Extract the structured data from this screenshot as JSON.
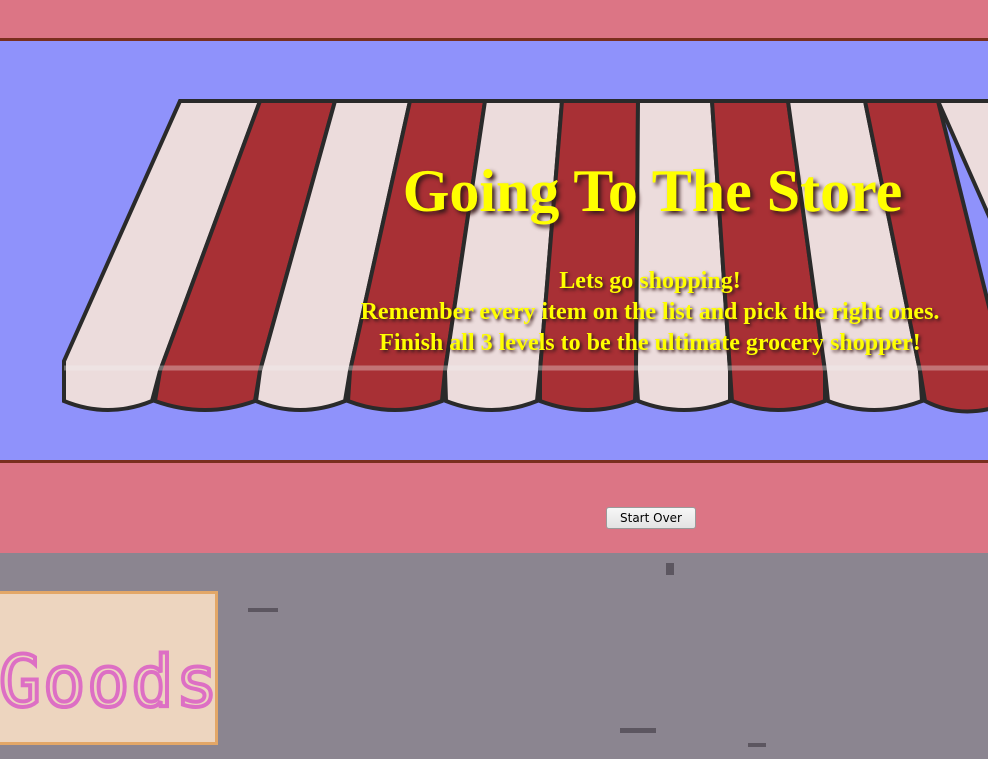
{
  "game": {
    "title": "Going To The Store",
    "messages": [
      "Lets go shopping!",
      "Remember every item on the list and pick the right ones.",
      "Finish all 3 levels to be the ultimate grocery shopper!"
    ],
    "start_over_label": "Start Over",
    "sign_text": "Goods"
  },
  "colors": {
    "top_band": "#dc7585",
    "sky": "#8f92fb",
    "awning_red": "#a83035",
    "awning_white": "#ecdcdc",
    "ground": "#8b8590",
    "title_text": "#ffff00",
    "sign_bg": "#edd5bf",
    "sign_text": "#dd6fc4"
  }
}
